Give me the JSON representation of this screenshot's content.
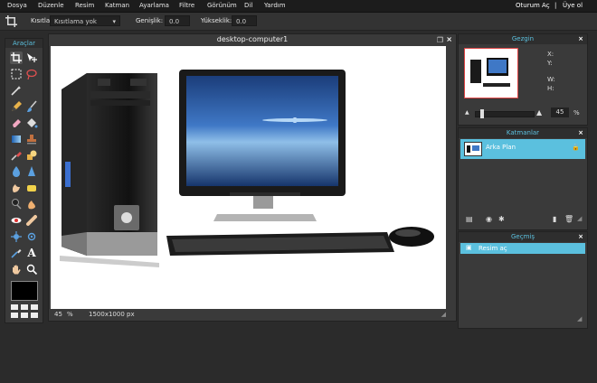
{
  "menu": {
    "items": [
      "Dosya",
      "Düzenle",
      "Resim",
      "Katman",
      "Ayarlama",
      "Filtre",
      "Görünüm",
      "Dil",
      "Yardım"
    ],
    "login": "Oturum Aç",
    "separator": "|",
    "signup": "Üye ol"
  },
  "options": {
    "crop_label": "Kısıtla:",
    "crop_value": "Kısıtlama yok",
    "width_label": "Genişlik:",
    "width_value": "0.0",
    "height_label": "Yükseklik:",
    "height_value": "0.0"
  },
  "tools": {
    "title": "Araçlar",
    "icons": [
      "crop-icon",
      "move-icon",
      "marquee-icon",
      "lasso-icon",
      "magic-wand-icon",
      "pencil-icon",
      "brush-icon",
      "eraser-icon",
      "fill-bucket-icon",
      "gradient-icon",
      "clone-stamp-icon",
      "color-replace-icon",
      "drawing-icon",
      "blur-icon",
      "sharpen-icon",
      "smudge-icon",
      "sponge-icon",
      "dodge-icon",
      "burn-icon",
      "red-eye-icon",
      "spot-heal-icon",
      "bloat-icon",
      "pinch-icon",
      "color-picker-icon",
      "text-icon",
      "hand-icon",
      "zoom-icon"
    ]
  },
  "canvas": {
    "title": "desktop-computer1",
    "zoom": "45",
    "zoom_unit": "%",
    "dimensions": "1500x1000 px"
  },
  "navigator": {
    "title": "Gezgin",
    "x_label": "X:",
    "y_label": "Y:",
    "w_label": "W:",
    "h_label": "H:",
    "zoom": "45",
    "zoom_unit": "%",
    "zoom_level": 0.45
  },
  "layers": {
    "title": "Katmanlar",
    "items": [
      {
        "name": "Arka Plan"
      }
    ]
  },
  "history": {
    "title": "Geçmiş",
    "items": [
      {
        "name": "Resim aç"
      }
    ]
  },
  "colors": {
    "accent": "#5bc0de",
    "foreground": "#000000"
  }
}
